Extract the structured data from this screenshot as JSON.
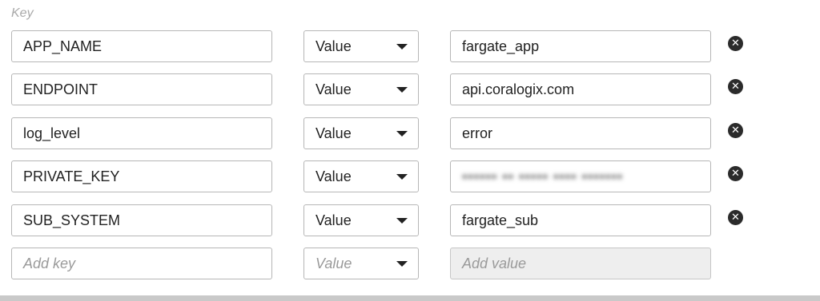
{
  "header": {
    "key_label": "Key"
  },
  "rows": [
    {
      "key": "APP_NAME",
      "type": "Value",
      "value": "fargate_app"
    },
    {
      "key": "ENDPOINT",
      "type": "Value",
      "value": "api.coralogix.com"
    },
    {
      "key": "log_level",
      "type": "Value",
      "value": "error"
    },
    {
      "key": "PRIVATE_KEY",
      "type": "Value",
      "value": ""
    },
    {
      "key": "SUB_SYSTEM",
      "type": "Value",
      "value": "fargate_sub"
    }
  ],
  "new_row": {
    "key_placeholder": "Add key",
    "type_placeholder": "Value",
    "value_placeholder": "Add value"
  },
  "icons": {
    "remove": "close-circle-icon",
    "dropdown": "caret-down-icon"
  }
}
